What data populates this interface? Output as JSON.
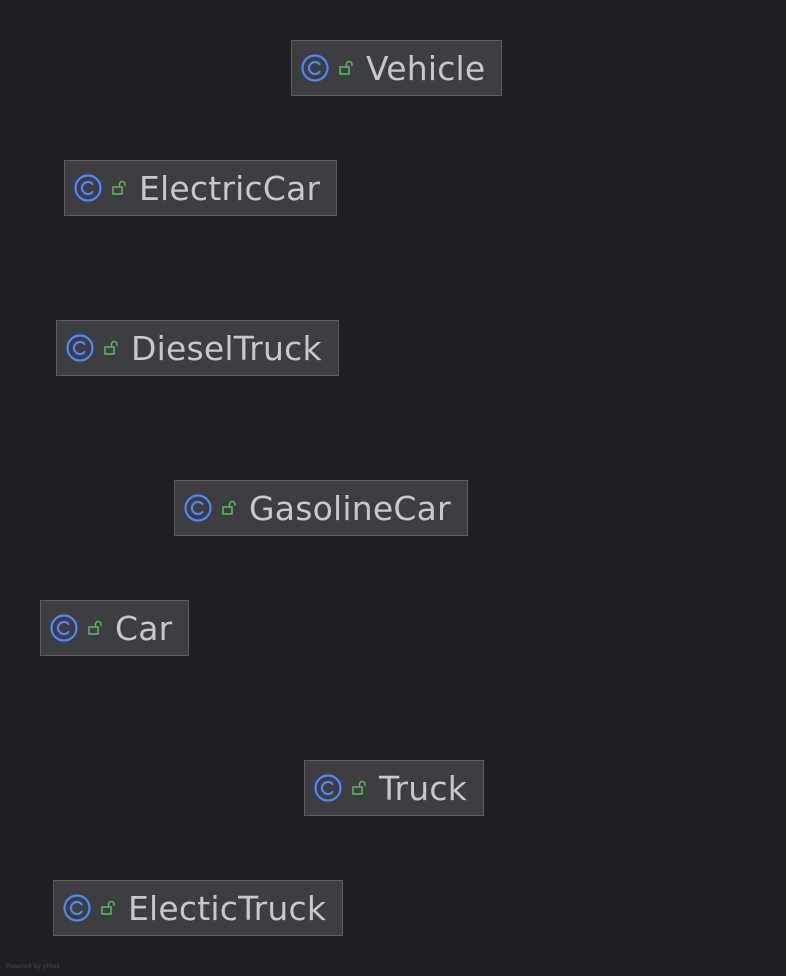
{
  "diagram": {
    "classes": [
      {
        "name": "Vehicle",
        "kind": "class",
        "visibility": "public"
      },
      {
        "name": "ElectricCar",
        "kind": "class",
        "visibility": "public"
      },
      {
        "name": "DieselTruck",
        "kind": "class",
        "visibility": "public"
      },
      {
        "name": "GasolineCar",
        "kind": "class",
        "visibility": "public"
      },
      {
        "name": "Car",
        "kind": "class",
        "visibility": "public"
      },
      {
        "name": "Truck",
        "kind": "class",
        "visibility": "public"
      },
      {
        "name": "ElecticTruck",
        "kind": "class",
        "visibility": "public"
      }
    ],
    "icons": {
      "class_icon": "class-c-icon",
      "visibility_icon": "unlocked-public-icon"
    },
    "colors": {
      "background": "#1f2023",
      "node_fill": "#3c3e41",
      "node_border": "#5a5d61",
      "text": "#c5c8cc",
      "class_icon": "#4f86f7",
      "visibility_icon": "#5fb15f"
    }
  },
  "footer": {
    "credit": "Powered by yFiles"
  }
}
